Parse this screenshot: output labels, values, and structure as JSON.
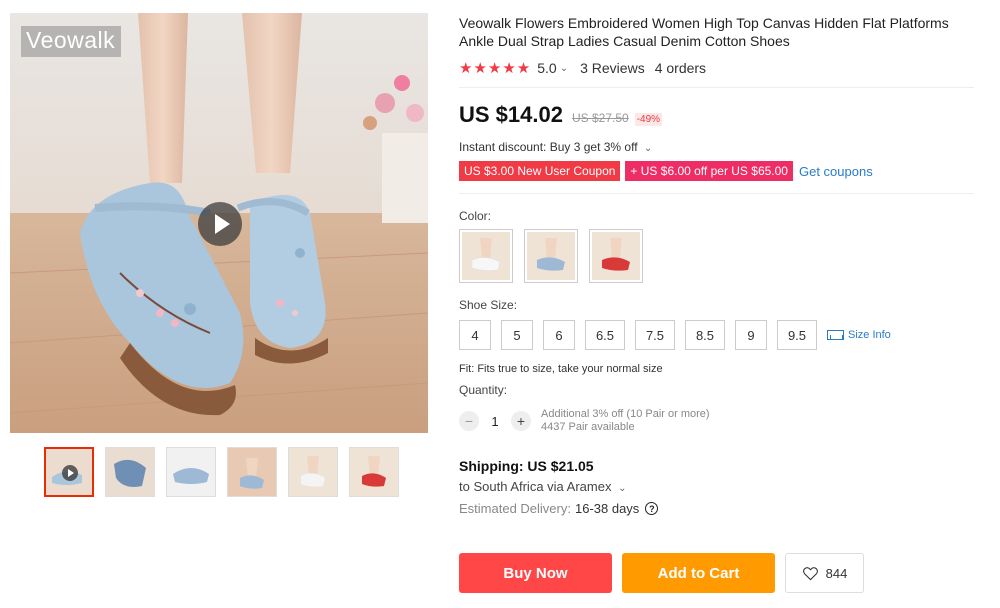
{
  "gallery": {
    "brand": "Veowalk",
    "thumbnails": [
      "video-thumbnail",
      "thumbnail-2",
      "thumbnail-3",
      "thumbnail-4",
      "thumbnail-5",
      "thumbnail-6"
    ]
  },
  "product": {
    "title": "Veowalk Flowers Embroidered Women High Top Canvas Hidden Flat Platforms Ankle Dual Strap Ladies Casual Denim Cotton Shoes",
    "stars": "★★★★★",
    "rating": "5.0",
    "reviews": "3 Reviews",
    "orders": "4 orders"
  },
  "price": {
    "current": "US $14.02",
    "original": "US $27.50",
    "discount": "-49%",
    "instant_discount": "Instant discount: Buy 3 get 3% off",
    "coupons": [
      "US $3.00 New User Coupon",
      "+ US $6.00 off per US $65.00"
    ],
    "get_coupons": "Get coupons"
  },
  "options": {
    "color_label": "Color:",
    "colors": [
      "white",
      "blue",
      "red"
    ],
    "size_label": "Shoe Size:",
    "sizes": [
      "4",
      "5",
      "6",
      "6.5",
      "7.5",
      "8.5",
      "9",
      "9.5"
    ],
    "size_info": "Size Info",
    "fit": "Fit: Fits true to size, take your normal size",
    "quantity_label": "Quantity:",
    "quantity": "1",
    "qty_minus": "−",
    "qty_plus": "+",
    "qty_note_1": "Additional 3% off (10 Pair or more)",
    "qty_note_2": "4437 Pair available"
  },
  "shipping": {
    "title": "Shipping: US $21.05",
    "destination": "to South Africa via Aramex",
    "estimated_label": "Estimated Delivery:",
    "estimated_days": "16-38 days",
    "help": "?"
  },
  "actions": {
    "buy_now": "Buy Now",
    "add_to_cart": "Add to Cart",
    "wishlist_count": "844"
  },
  "colors": {
    "accent_red": "#ff4747",
    "cart_orange": "#ff9a00",
    "coupon_red": "#f03a45",
    "coupon_pink": "#ee2d64",
    "link_blue": "#2a7bc7"
  }
}
